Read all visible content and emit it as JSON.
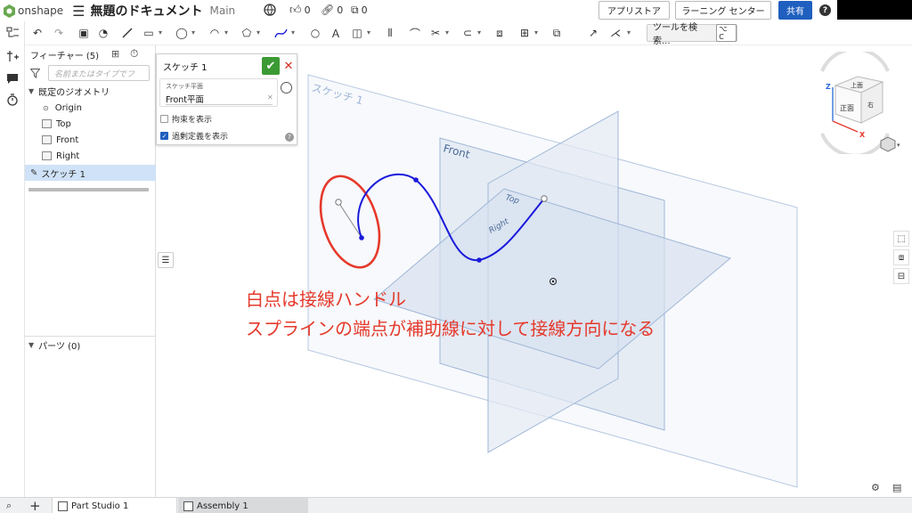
{
  "header": {
    "logo_text": "onshape",
    "document_title": "無題のドキュメント",
    "workspace": "Main",
    "likes_count": "0",
    "links_count": "0",
    "copies_count": "0",
    "app_store_label": "アプリストア",
    "learning_center_label": "ラーニング センター",
    "share_label": "共有"
  },
  "toolbar": {
    "search_label": "ツールを検索...",
    "search_shortcut": "⌥ C"
  },
  "feature_panel": {
    "title": "フィーチャー (5)",
    "search_placeholder": "名前またはタイプでフ",
    "default_geometry_label": "既定のジオメトリ",
    "items": [
      {
        "label": "Origin"
      },
      {
        "label": "Top"
      },
      {
        "label": "Front"
      },
      {
        "label": "Right"
      },
      {
        "label": "スケッチ 1"
      }
    ],
    "parts_label": "パーツ (0)"
  },
  "sketch_dialog": {
    "name": "スケッチ 1",
    "plane_label": "スケッチ平面",
    "plane_value": "Front平面",
    "show_constraints_label": "拘束を表示",
    "show_constraints_checked": false,
    "show_overdefined_label": "過剰定義を表示",
    "show_overdefined_checked": true
  },
  "viewport": {
    "sketch_plane_label": "スケッチ 1",
    "front_plane_label": "Front",
    "top_plane_label": "Top",
    "right_plane_label": "Right",
    "annotation_line1": "白点は接線ハンドル",
    "annotation_line2": "スプラインの端点が補助線に対して接線方向になる",
    "spline_color": "#1a1adb",
    "ellipse_color": "#e5392b",
    "plane_fill": "#dde6f3",
    "plane_stroke": "#9fb6d6"
  },
  "view_cube": {
    "top_face": "上面",
    "front_face": "正面",
    "right_face": "右",
    "axis_z": "Z",
    "axis_x": "X"
  },
  "bottom_tabs": [
    {
      "label": "Part Studio 1",
      "active": true
    },
    {
      "label": "Assembly 1",
      "active": false
    }
  ]
}
